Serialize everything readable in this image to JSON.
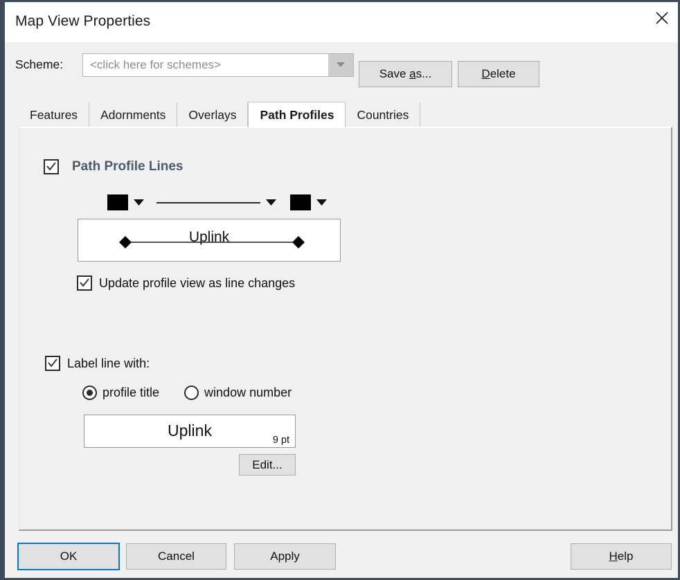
{
  "window": {
    "title": "Map View Properties",
    "close_icon": "close-icon"
  },
  "scheme": {
    "label": "Scheme:",
    "placeholder": "<click here for schemes>",
    "value": "",
    "dropdown_icon": "chevron-down-icon",
    "save_as_label_pre": "Save ",
    "save_as_label_accel": "a",
    "save_as_label_post": "s...",
    "delete_label_accel": "D",
    "delete_label_post": "elete"
  },
  "tabs": [
    {
      "label": "Features",
      "selected": false
    },
    {
      "label": "Adornments",
      "selected": false
    },
    {
      "label": "Overlays",
      "selected": false
    },
    {
      "label": "Path Profiles",
      "selected": true
    },
    {
      "label": "Countries",
      "selected": false
    }
  ],
  "path_profiles": {
    "lines_group": {
      "label": "Path Profile Lines",
      "checked": true,
      "label_color": "#4e5a66"
    },
    "style_controls": {
      "start_symbol_color": "#000000",
      "line_color": "#000000",
      "line_style_name": "solid",
      "dropdown_icon": "chevron-down-icon"
    },
    "line_preview": {
      "label": "Uplink",
      "marker_shape": "diamond",
      "line_color": "#000000"
    },
    "update_checkbox": {
      "label": "Update profile view as line changes",
      "checked": true
    },
    "label_line": {
      "label": "Label line with:",
      "checked": true,
      "options": [
        {
          "label": "profile title",
          "selected": true
        },
        {
          "label": "window number",
          "selected": false
        }
      ],
      "font_preview": {
        "sample_text": "Uplink",
        "size_label": "9 pt"
      },
      "edit_label": "Edit..."
    }
  },
  "footer": {
    "ok_label": "OK",
    "cancel_label": "Cancel",
    "apply_label": "Apply",
    "help_label_accel": "H",
    "help_label_post": "elp",
    "default_focus_color": "#0078d7"
  }
}
